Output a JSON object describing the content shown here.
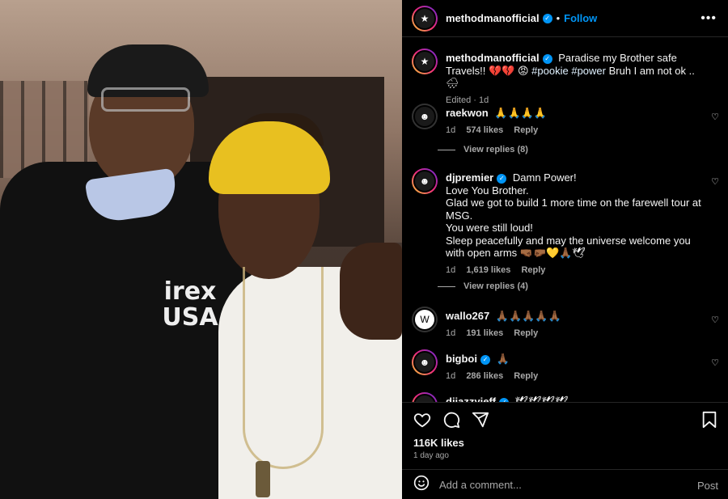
{
  "photo": {
    "hoodie_text": "irex USA"
  },
  "header": {
    "username": "methodmanofficial",
    "separator": "•",
    "follow_label": "Follow",
    "more_label": "•••"
  },
  "caption": {
    "username": "methodmanofficial",
    "text_1": "Paradise my Brother safe Travels!! 💔💔",
    "emoji_2": "😡",
    "hashtag_1": "#pookie",
    "hashtag_2": "#power",
    "text_3": "Bruh I am not ok .. 🌧",
    "meta": "Edited · 1d"
  },
  "comments": [
    {
      "username": "raekwon",
      "text": "🙏🙏🙏🙏",
      "time": "1d",
      "likes": "574 likes",
      "reply": "Reply",
      "view_replies": "View replies (8)"
    },
    {
      "username": "djpremier",
      "text_lines": [
        "Damn Power!",
        "Love You Brother.",
        "Glad we got to build 1 more time on the farewell tour at MSG.",
        "You were still loud!",
        "Sleep peacefully and may the universe welcome you with open arms 🤜🏾🤛🏾💛🙏🏾🕊"
      ],
      "time": "1d",
      "likes": "1,619 likes",
      "reply": "Reply",
      "view_replies": "View replies (4)"
    },
    {
      "username": "wallo267",
      "text": "🙏🏾🙏🏾🙏🏾🙏🏾🙏🏾",
      "time": "1d",
      "likes": "191 likes",
      "reply": "Reply"
    },
    {
      "username": "bigboi",
      "text": "🙏🏾",
      "time": "1d",
      "likes": "286 likes",
      "reply": "Reply"
    },
    {
      "username": "djjazzyjeff",
      "text": "🕊🕊🕊🕊"
    }
  ],
  "footer": {
    "likes": "116K likes",
    "ago": "1 day ago",
    "placeholder": "Add a comment...",
    "post_label": "Post"
  },
  "colors": {
    "accent": "#0095f6",
    "background": "#000000",
    "muted": "#a8a8a8"
  }
}
